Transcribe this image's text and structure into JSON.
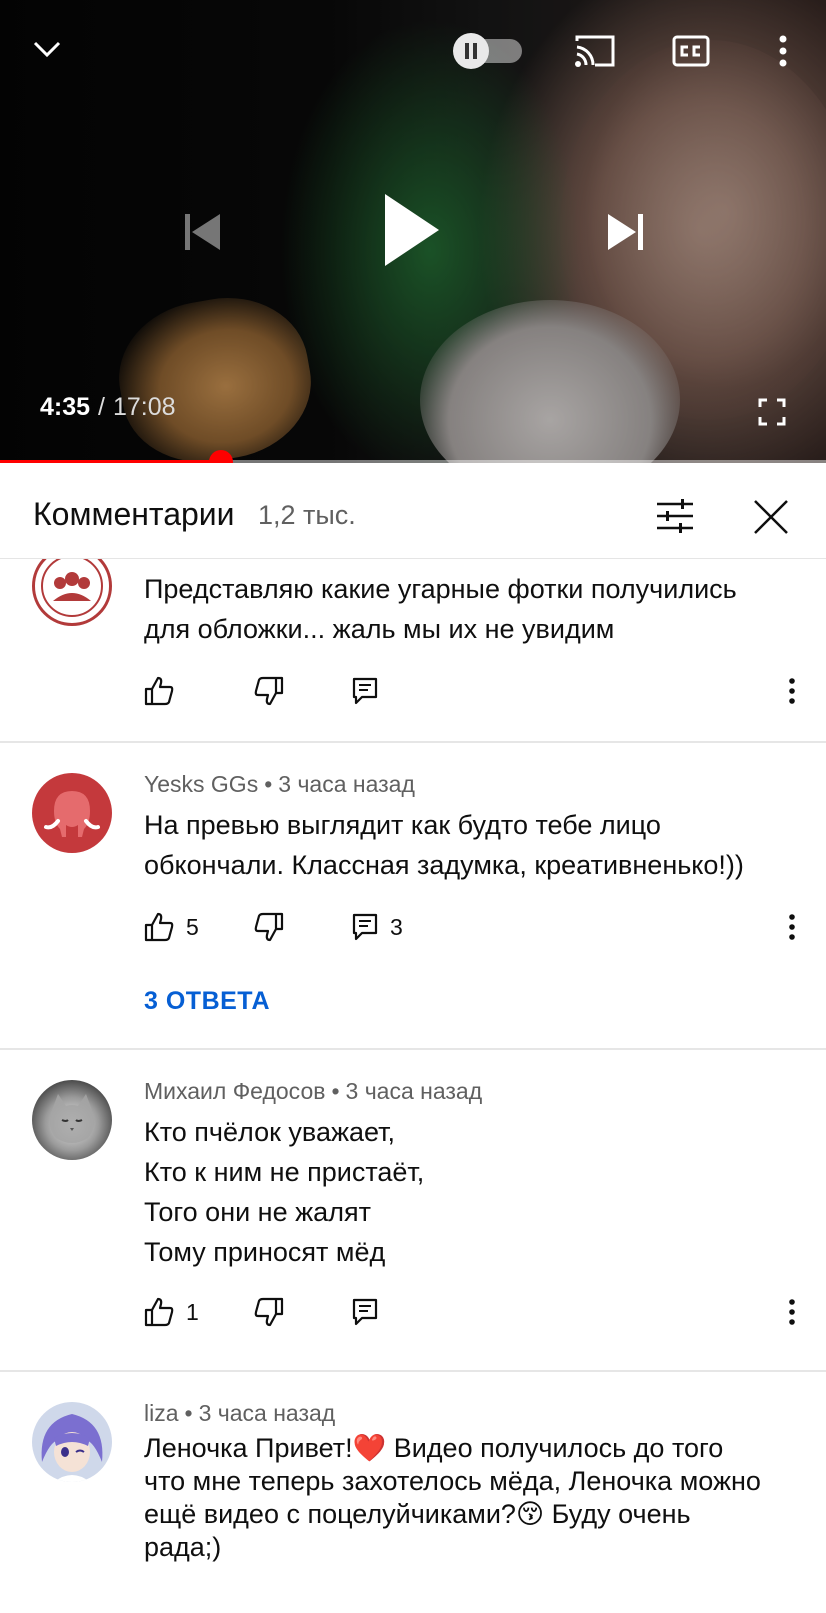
{
  "player": {
    "current_time": "4:35",
    "separator": "/",
    "duration": "17:08",
    "progress": 0.268
  },
  "comments_panel": {
    "title": "Комментарии",
    "count": "1,2 тыс."
  },
  "comments": [
    {
      "author": "",
      "time": "",
      "text": "Представляю какие угарные фотки получились\nдля обложки... жаль мы их не увидим",
      "likes": "",
      "replies_count": "",
      "avatar": "red-crowd-logo"
    },
    {
      "author": "Yesks GGs",
      "time": "3 часа назад",
      "text": "На превью выглядит как будто тебе лицо\nобкончали. Классная задумка, креативненько!))",
      "likes": "5",
      "replies_count": "3",
      "replies_link": "3 ОТВЕТА",
      "avatar": "red-elephant"
    },
    {
      "author": "Михаил Федосов",
      "time": "3 часа назад",
      "text": "Кто пчёлок уважает,\nКто к ним не пристаёт,\nТого они не жалят\nТому приносят мёд",
      "likes": "1",
      "replies_count": "",
      "avatar": "grey-cat-photo"
    },
    {
      "author": "liza",
      "time": "3 часа назад",
      "text": "Леночка Привет!❤️ Видео получилось до того\nчто мне теперь захотелось мёда, Леночка можно\nещё видео с поцелуйчиками?😚 Буду очень\nрада;)",
      "likes": "",
      "replies_count": "",
      "avatar": "anime-girl"
    }
  ],
  "colors": {
    "accent_red": "#ff0000",
    "link_blue": "#065fd4",
    "secondary_text": "#606060"
  }
}
